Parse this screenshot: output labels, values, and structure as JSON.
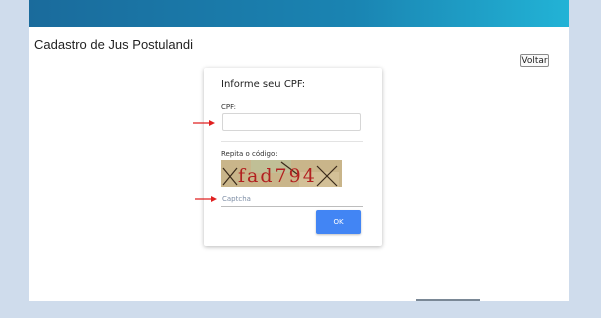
{
  "page": {
    "title": "Cadastro de Jus Postulandi",
    "back_button": "Voltar"
  },
  "form": {
    "heading": "Informe seu CPF:",
    "cpf_label": "CPF:",
    "cpf_value": "",
    "captcha_label": "Repita o código:",
    "captcha_image_text": "fad794",
    "captcha_placeholder": "Captcha",
    "ok_button": "OK"
  },
  "colors": {
    "topbar_start": "#1a6b9c",
    "topbar_end": "#22b3d6",
    "ok_button": "#4285f4",
    "annotation_arrow": "#e02020"
  },
  "icons": [
    "red-arrow-annotation-icon"
  ]
}
